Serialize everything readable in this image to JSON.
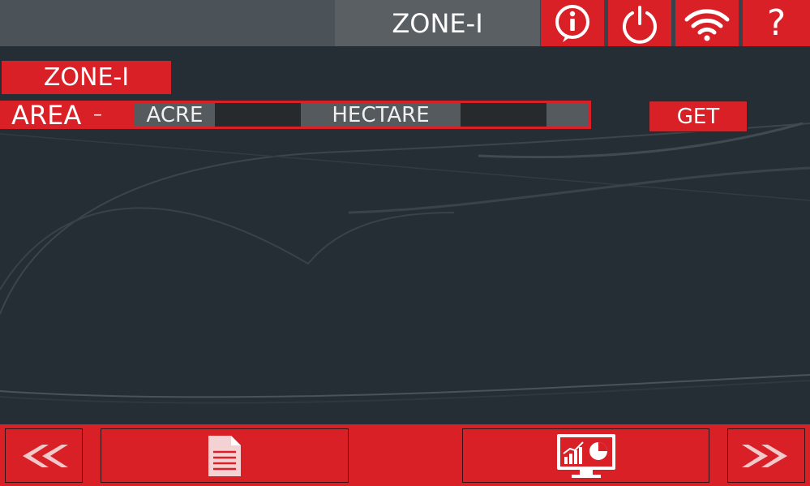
{
  "header": {
    "title": "ZONE-I",
    "icons": [
      "info-icon",
      "power-icon",
      "wifi-icon",
      "help-icon"
    ],
    "help_glyph": "?"
  },
  "main": {
    "zone_label": "ZONE-I",
    "area_label": "AREA",
    "area_dash": "–",
    "acre_label": "ACRE",
    "acre_value": "",
    "hectare_label": "HECTARE",
    "hectare_value": "",
    "get_label": "GET"
  },
  "footer": {
    "icons": [
      "double-chevron-left-icon",
      "document-icon",
      "analytics-monitor-icon",
      "double-chevron-right-icon"
    ]
  },
  "colors": {
    "accent": "#d92027",
    "background": "#252d35",
    "topbar": "#3a4148",
    "value_box": "#272a2d"
  }
}
